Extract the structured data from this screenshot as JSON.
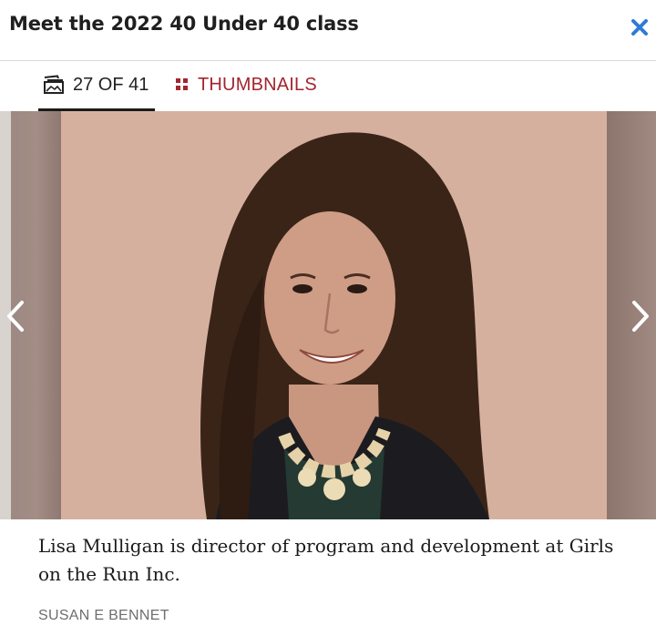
{
  "header": {
    "title": "Meet the 2022 40 Under 40 class",
    "close_icon": "close-x-icon",
    "close_color": "#2f7bd6"
  },
  "toolbar": {
    "counter_icon": "gallery-icon",
    "counter_text": "27 OF 41",
    "thumbnails_icon": "grid-dots-icon",
    "thumbnails_label": "THUMBNAILS",
    "accent_color": "#a3262d"
  },
  "slide": {
    "image": "portrait-photo",
    "prev_icon": "chevron-left-icon",
    "next_icon": "chevron-right-icon",
    "caption": "Lisa Mulligan is director of program and development at Girls on the Run Inc.",
    "credit": "SUSAN E BENNET"
  }
}
